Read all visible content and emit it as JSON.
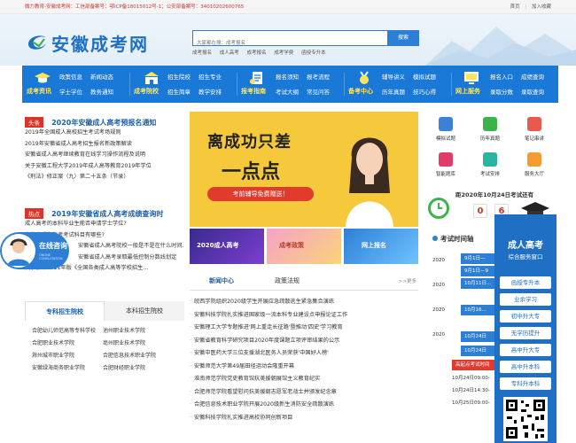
{
  "topbar": {
    "left": "微力教育-安徽成考网：工信部备案号：鄂ICP备18015012号-1；公安部备案号：34010202600765",
    "home": "首页",
    "favorite": "加入收藏"
  },
  "header": {
    "logo_text": "安徽成考网",
    "search_placeholder": "大家都在搜：成考报名",
    "search_button": "搜索",
    "hot_links": [
      "成考报名",
      "成人高考",
      "成考报名",
      "成考学费",
      "函授专升本"
    ]
  },
  "nav": [
    {
      "head": "成考资讯",
      "links": [
        "政策信息",
        "新闻动态",
        "学士学位",
        "教务通知"
      ]
    },
    {
      "head": "成考院校",
      "links": [
        "招生院校",
        "招生专业",
        "招生简章",
        "教学安排"
      ]
    },
    {
      "head": "报考指南",
      "links": [
        "报名须知",
        "报考流程",
        "考试大纲",
        "常见问答"
      ]
    },
    {
      "head": "备考中心",
      "links": [
        "辅导讲义",
        "模拟试题",
        "历年真题",
        "技巧心得"
      ]
    },
    {
      "head": "网上服务",
      "links": [
        "报名入口",
        "成绩查询",
        "录取分数",
        "录取查询"
      ]
    }
  ],
  "headline": {
    "tag": "头条",
    "title": "2020年安徽成人高考预报名通知",
    "items": [
      "2019年全国成人高校招生考试考场规则",
      "2019年安徽省成人高考招生报名新政策解读",
      "安徽省成人高考继续教育在线学习操作流程及说明",
      "关于安徽工程大学2019年成人高等教育2019年学位",
      "《刑法》修正案（九）第二十五条（节录）"
    ]
  },
  "hot": {
    "tag": "热点",
    "title": "2019年安徽省成人高考成绩查询时",
    "items": [
      "成人高考的本科毕业生能否申请学士学位?",
      "安徽省成人高考考试科目有哪些?",
      "安徽省成人高考院校一般是不是在什么时间…",
      "安徽省成人高考录取最低控制分数线划定",
      "关于颁布2011年版《全国各类成人高等学校招生…"
    ]
  },
  "chat": {
    "title": "在线咨询",
    "subtitle": "ONLINE CONSULTATION"
  },
  "banner": {
    "line1": "离成功只差",
    "line2": "一点点",
    "pill": "考前辅导免费赠送！"
  },
  "thumbs": [
    {
      "text": "2020成人高考"
    },
    {
      "text": "成考政策"
    },
    {
      "text": "网上报名"
    }
  ],
  "news_tabs": {
    "active": "新闻中心",
    "other": "政策法规",
    "more": ">>更多"
  },
  "news": [
    "皖西学院组织2020级学生开展应急疏散逃生紧急集合演练",
    "安徽科技学院扎实推进国家级一流本科专业建设点申报论证工作",
    "安徽理工大学专题推进'网上重走长征路'暨推动'四史'学习教育",
    "安徽省教育科学研究项目2020年度课题立项评审结果的公示",
    "安徽中医药大学三位支援湖北医务人员荣获'中国好人榜'",
    "安徽师范大学第49届田径运动会隆重开幕",
    "淮南师范学院党史教育馆抗美援朝展馆主义教育纪实",
    "合肥师范学院看望慰问抗美援朝志愿军老战士并颁发纪念章",
    "合肥信息技术职业学院开展2020级新生消防安全疏散演练",
    "安徽科技学院扎实推进高校协同创新项目"
  ],
  "school_tabs": {
    "active": "专科招生院校",
    "other": "本科招生院校"
  },
  "schools": [
    [
      "合肥幼儿师范高等专科学校",
      "池州职业技术学院"
    ],
    [
      "合肥职业技术学院",
      "亳州职业技术学院"
    ],
    [
      "滁州城市职业学院",
      "合肥信息技术职业学院"
    ],
    [
      "安徽绿海商务职业学院",
      "合肥财经职业学院"
    ]
  ],
  "tools": [
    "模拟试题",
    "历年真题",
    "笔记串讲",
    "智能题库",
    "考试安排",
    "服务大厅"
  ],
  "countdown": {
    "text": "距2020年10月24日考试还有",
    "d1": "0",
    "d2": "6"
  },
  "schedule": {
    "title": "考试时间轴",
    "years": [
      "2020",
      "2020",
      "2020",
      "2020",
      "2020",
      "2020",
      "2020"
    ],
    "items": [
      "9月1日—",
      "9月1日—9",
      "10月11日…",
      "10月16…",
      "10月24日",
      "10月24日",
      "高起点考试时间"
    ],
    "times": [
      "10月24日09:00-",
      "10月24日14:30-",
      "10月25日09:00-"
    ]
  },
  "sidepanel": {
    "title": "成人高考",
    "subtitle": "综合服务窗口",
    "buttons": [
      "函授专升本",
      "业余学习",
      "初中升大专",
      "无学历提升",
      "高中升大专",
      "高中升本科",
      "专科升本科"
    ]
  }
}
